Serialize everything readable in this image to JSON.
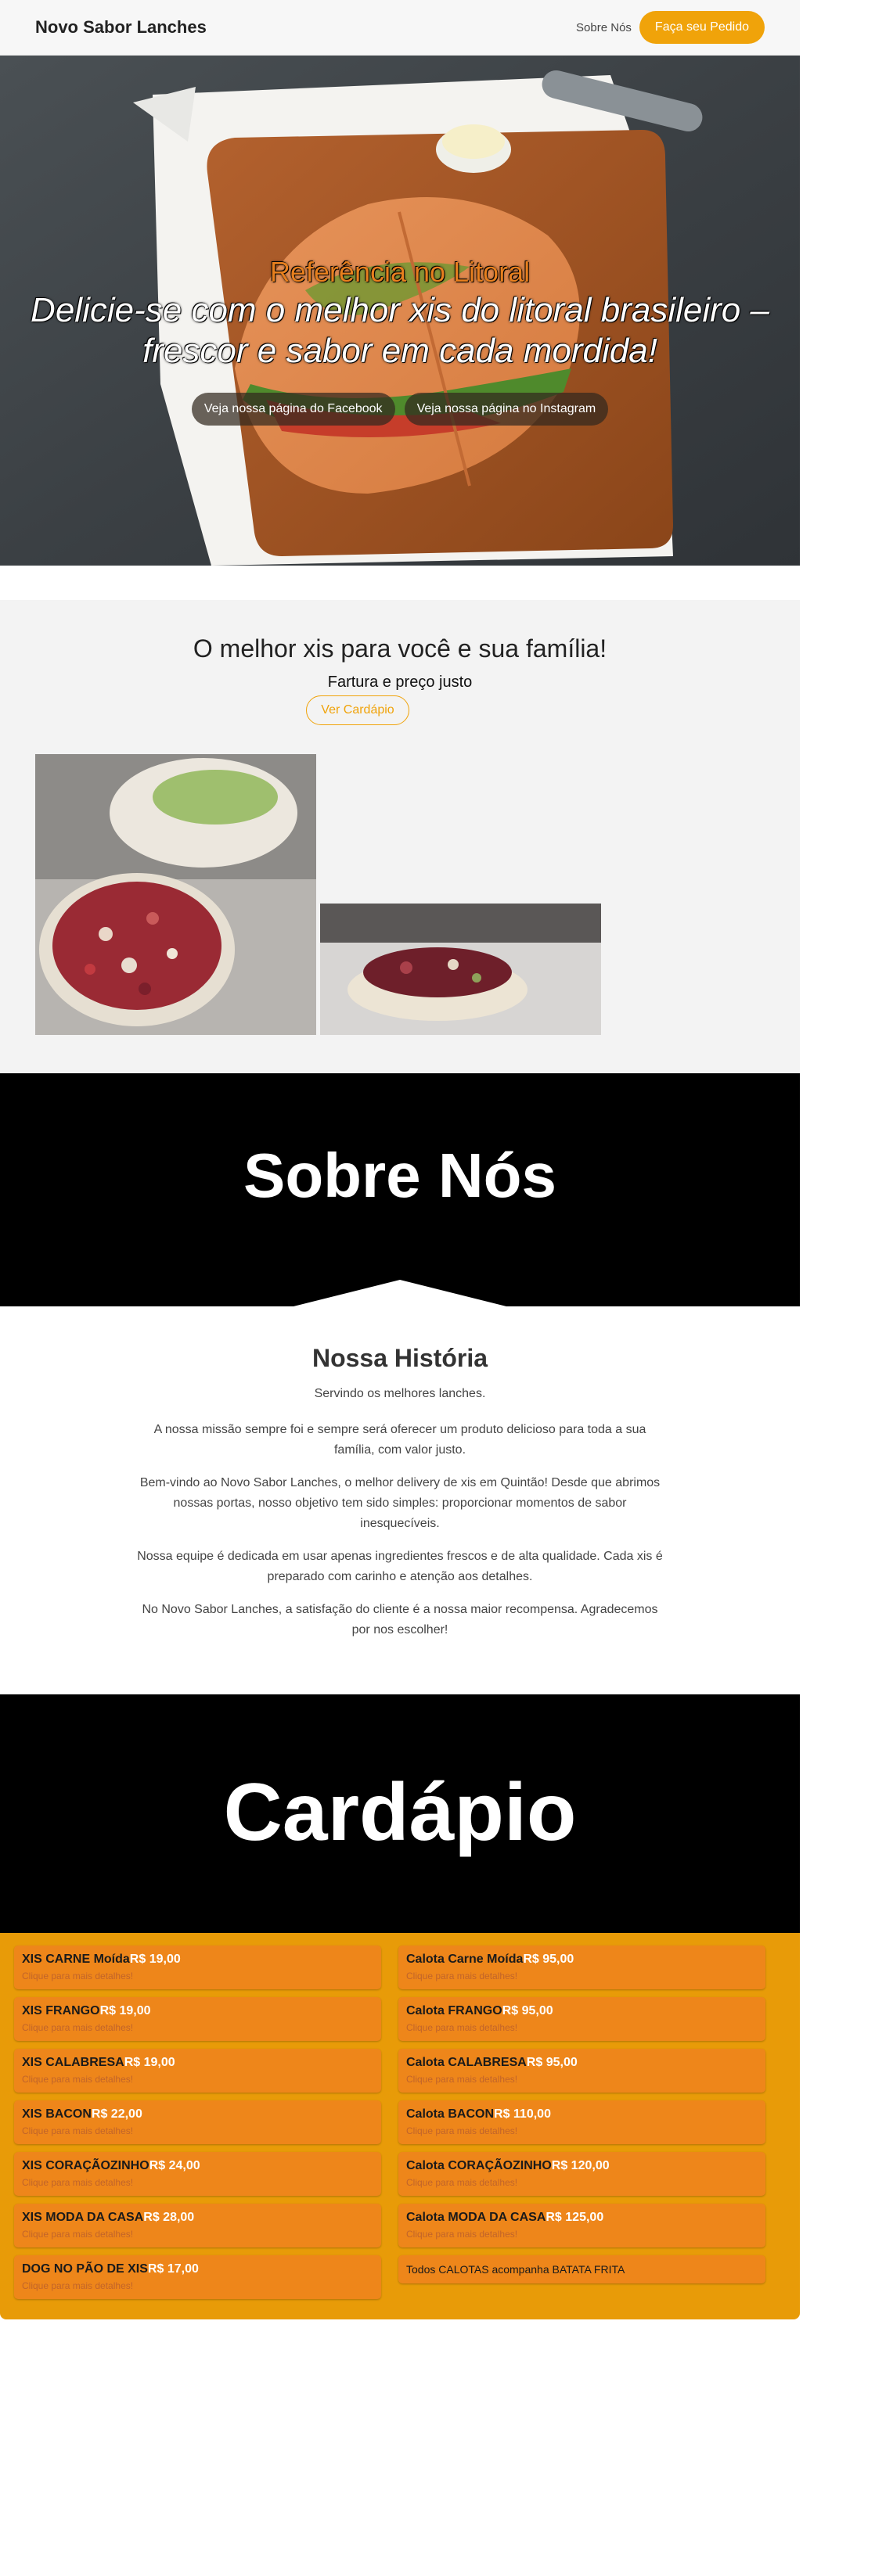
{
  "header": {
    "brand": "Novo Sabor Lanches",
    "about_link": "Sobre Nós",
    "order_button": "Faça seu Pedido"
  },
  "hero": {
    "kicker": "Referência no Litoral",
    "title": "Delicie-se com o melhor xis do litoral brasileiro – frescor e sabor em cada mordida!",
    "facebook_button": "Veja nossa página do Facebook",
    "instagram_button": "Veja nossa página no Instagram"
  },
  "promo": {
    "title": "O melhor xis para você e sua família!",
    "subtitle": "Fartura e preço justo",
    "menu_button": "Ver Cardápio"
  },
  "about": {
    "banner": "Sobre Nós",
    "heading": "Nossa História",
    "subline": "Servindo os melhores lanches.",
    "paragraphs": [
      "A nossa missão sempre foi e sempre será oferecer um produto delicioso para toda a sua família, com valor justo.",
      "Bem-vindo ao Novo Sabor Lanches, o melhor delivery de xis em Quintão! Desde que abrimos nossas portas, nosso objetivo tem sido simples: proporcionar momentos de sabor inesquecíveis.",
      "Nossa equipe é dedicada em usar apenas ingredientes frescos e de alta qualidade. Cada xis é preparado com carinho e atenção aos detalhes.",
      "No Novo Sabor Lanches, a satisfação do cliente é a nossa maior recompensa. Agradecemos por nos escolher!"
    ]
  },
  "menu": {
    "banner": "Cardápio",
    "hint": "Clique para mais detalhes!",
    "left": [
      {
        "name": "XIS CARNE Moída",
        "price": "R$ 19,00"
      },
      {
        "name": "XIS FRANGO",
        "price": "R$ 19,00"
      },
      {
        "name": "XIS CALABRESA",
        "price": "R$ 19,00"
      },
      {
        "name": "XIS BACON",
        "price": "R$ 22,00"
      },
      {
        "name": "XIS CORAÇÃOZINHO",
        "price": "R$ 24,00"
      },
      {
        "name": "XIS MODA DA CASA",
        "price": "R$ 28,00"
      },
      {
        "name": "DOG NO PÃO DE XIS",
        "price": "R$ 17,00"
      }
    ],
    "right": [
      {
        "name": "Calota Carne Moída",
        "price": "R$ 95,00"
      },
      {
        "name": "Calota FRANGO",
        "price": "R$ 95,00"
      },
      {
        "name": "Calota CALABRESA",
        "price": "R$ 95,00"
      },
      {
        "name": "Calota BACON",
        "price": "R$ 110,00"
      },
      {
        "name": "Calota CORAÇÃOZINHO",
        "price": "R$ 120,00"
      },
      {
        "name": "Calota MODA DA CASA",
        "price": "R$ 125,00"
      }
    ],
    "note": "Todos CALOTAS acompanha BATATA FRITA"
  },
  "colors": {
    "accent": "#f0a30a",
    "menu_bg": "#e89b08",
    "card_bg": "#ee861a",
    "banner_bg": "#000000"
  }
}
